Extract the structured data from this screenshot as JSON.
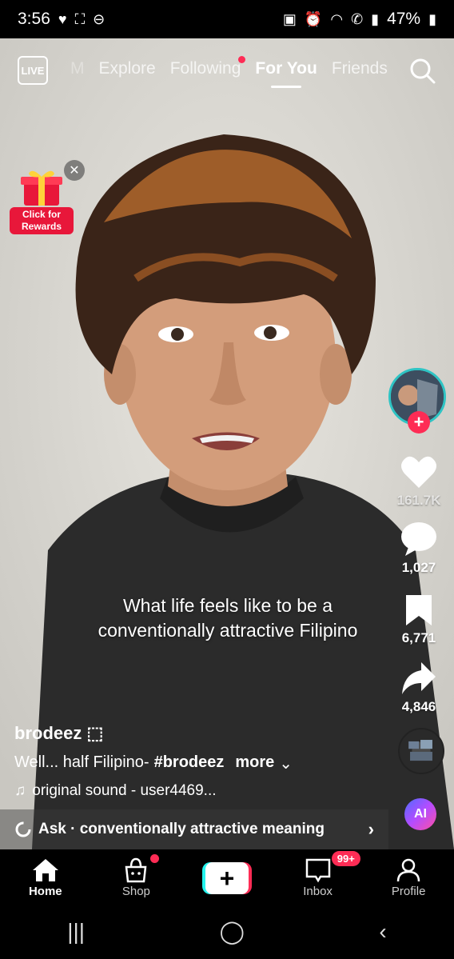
{
  "status": {
    "time": "3:56",
    "battery": "47%"
  },
  "top_nav": {
    "live": "LIVE",
    "tabs": [
      "M",
      "Explore",
      "Following",
      "For You",
      "Friends"
    ]
  },
  "rewards": {
    "label": "Click for Rewards"
  },
  "caption": "What life feels like to be a conventionally attractive Filipino",
  "actions": {
    "likes": "161.7K",
    "comments": "1,027",
    "saves": "6,771",
    "shares": "4,846"
  },
  "post": {
    "username": "brodeez ⬚",
    "desc_text": "Well... half Filipino-",
    "hashtag": "#brodeez",
    "more": "more",
    "sound": "original sound - user4469..."
  },
  "ask": {
    "label": "Ask · conventionally attractive meaning"
  },
  "ai": {
    "label": "AI"
  },
  "bottom_nav": {
    "home": "Home",
    "shop": "Shop",
    "inbox": "Inbox",
    "inbox_badge": "99+",
    "profile": "Profile"
  },
  "colors": {
    "accent": "#fe2c55",
    "cyan": "#25f4ee"
  }
}
